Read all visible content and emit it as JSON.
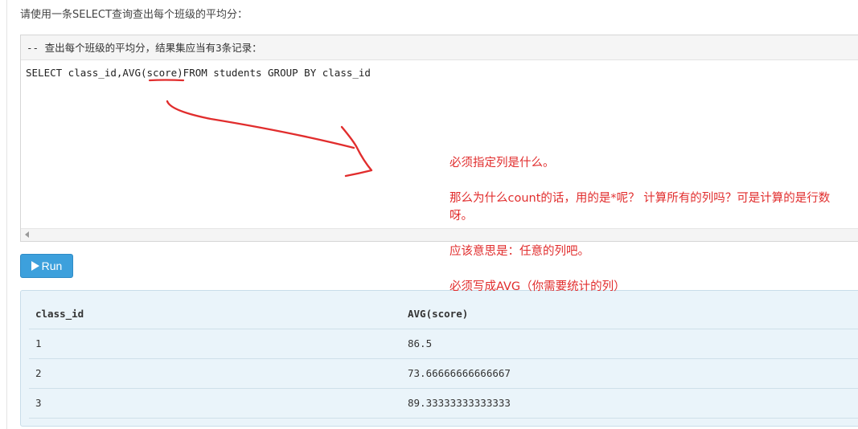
{
  "prompt": "请使用一条SELECT查询查出每个班级的平均分：",
  "editor": {
    "comment_line": "-- 查出每个班级的平均分，结果集应当有3条记录：",
    "code_line": "SELECT class_id,AVG(score)FROM students GROUP BY class_id"
  },
  "run_button": {
    "label": "Run"
  },
  "result": {
    "columns": [
      "class_id",
      "AVG(score)"
    ],
    "rows": [
      [
        "1",
        "86.5"
      ],
      [
        "2",
        "73.66666666666667"
      ],
      [
        "3",
        "89.33333333333333"
      ]
    ]
  },
  "annotations": {
    "line1": "必须指定列是什么。",
    "line2": "那么为什么count的话，用的是*呢？  计算所有的列吗？可是计算的是行数呀。",
    "line3": "应该意思是：任意的列吧。",
    "line4": "必须写成AVG（你需要统计的列）"
  },
  "colors": {
    "annotation_red": "#e12d2d",
    "run_button_blue": "#3da0dc",
    "result_background": "#eaf4fa"
  },
  "icons": {
    "run": "play-icon",
    "scroll_left": "scroll-left-arrow-icon"
  }
}
